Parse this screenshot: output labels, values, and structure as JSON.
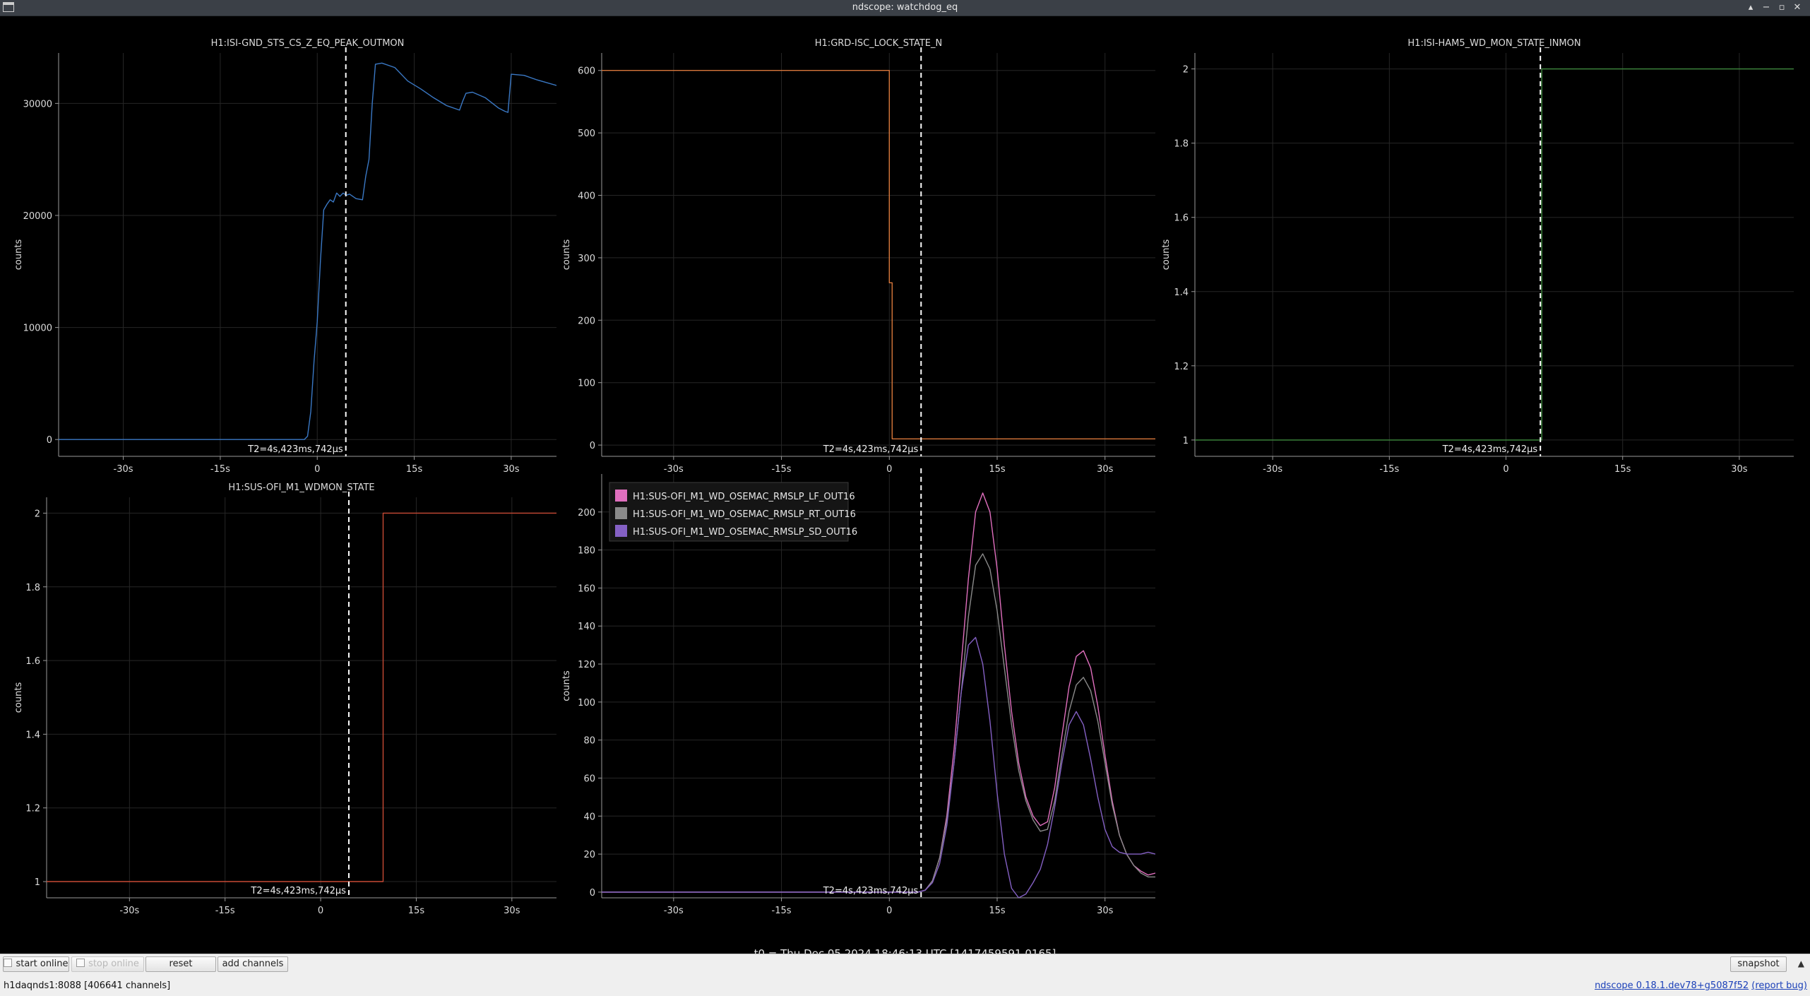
{
  "window": {
    "title": "ndscope: watchdog_eq",
    "controls": {
      "up": "▴",
      "minimize": "−",
      "maximize": "▫",
      "close": "✕"
    }
  },
  "cursor_label": "T2=4s,423ms,742µs",
  "cursor_t": 4.42,
  "t0_label": "t0 = Thu Dec 05 2024 18:46:13 UTC [1417459591.0165]",
  "toolbar": {
    "start_online": "start online",
    "stop_online": "stop online",
    "reset": "reset",
    "add_channels": "add channels",
    "snapshot": "snapshot"
  },
  "status": {
    "server": "h1daqnds1:8088  [406641 channels]",
    "version": "ndscope 0.18.1.dev78+g5087f52",
    "report_bug": "(report bug)"
  },
  "colors": {
    "background": "#000000",
    "grid": "#262626",
    "cursor": "#ffffff",
    "blue": "#3a78c4",
    "orange": "#d8773a",
    "green": "#3e8a3e",
    "red": "#c84a35",
    "pink": "#e06fbe",
    "gray": "#8a8a8a",
    "purple": "#8460c4"
  },
  "chart_data": [
    {
      "type": "line",
      "title": "H1:ISI-GND_STS_CS_Z_EQ_PEAK_OUTMON",
      "ylabel": "counts",
      "xlim": [
        -40,
        37
      ],
      "ylim": [
        -1500,
        34500
      ],
      "xticks": [
        -30,
        -15,
        0,
        15,
        30
      ],
      "xtick_labels": [
        "-30s",
        "-15s",
        "0",
        "15s",
        "30s"
      ],
      "yticks": [
        0,
        10000,
        20000,
        30000
      ],
      "ytick_labels": [
        "0",
        "10000",
        "20000",
        "30000"
      ],
      "grid": true,
      "series": [
        {
          "color": "#3a78c4",
          "x": [
            -40,
            -2,
            -1.5,
            -1,
            -0.5,
            0,
            0.5,
            1,
            1.5,
            2,
            2.5,
            3,
            3.5,
            4,
            4.5,
            5,
            6,
            7,
            7.5,
            8,
            8.5,
            9,
            10,
            12,
            14,
            16,
            18,
            20,
            22,
            22.5,
            23,
            24,
            26,
            28,
            29,
            29.5,
            30,
            32,
            34,
            37
          ],
          "y": [
            0,
            0,
            300,
            2500,
            7000,
            10500,
            16000,
            20500,
            21000,
            21400,
            21200,
            22000,
            21700,
            22000,
            21800,
            21900,
            21500,
            21400,
            23500,
            25000,
            30000,
            33500,
            33600,
            33200,
            32000,
            31300,
            30500,
            29800,
            29400,
            30200,
            30900,
            31000,
            30500,
            29600,
            29300,
            29200,
            32600,
            32500,
            32100,
            31600
          ]
        }
      ]
    },
    {
      "type": "line",
      "title": "H1:GRD-ISC_LOCK_STATE_N",
      "ylabel": "counts",
      "xlim": [
        -40,
        37
      ],
      "ylim": [
        -18,
        628
      ],
      "xticks": [
        -30,
        -15,
        0,
        15,
        30
      ],
      "xtick_labels": [
        "-30s",
        "-15s",
        "0",
        "15s",
        "30s"
      ],
      "yticks": [
        0,
        100,
        200,
        300,
        400,
        500,
        600
      ],
      "ytick_labels": [
        "0",
        "100",
        "200",
        "300",
        "400",
        "500",
        "600"
      ],
      "grid": true,
      "series": [
        {
          "color": "#d8773a",
          "x": [
            -40,
            0,
            0,
            0.4,
            0.4,
            37
          ],
          "y": [
            600,
            600,
            260,
            260,
            10,
            10
          ]
        }
      ]
    },
    {
      "type": "line",
      "title": "H1:ISI-HAM5_WD_MON_STATE_INMON",
      "ylabel": "counts",
      "xlim": [
        -40,
        37
      ],
      "ylim": [
        0.956,
        2.043
      ],
      "xticks": [
        -30,
        -15,
        0,
        15,
        30
      ],
      "xtick_labels": [
        "-30s",
        "-15s",
        "0",
        "15s",
        "30s"
      ],
      "yticks": [
        1,
        1.2,
        1.4,
        1.6,
        1.8,
        2
      ],
      "ytick_labels": [
        "1",
        "1.2",
        "1.4",
        "1.6",
        "1.8",
        "2"
      ],
      "grid": true,
      "series": [
        {
          "color": "#3e8a3e",
          "x": [
            -40,
            4.6,
            4.6,
            37
          ],
          "y": [
            1,
            1,
            2,
            2
          ]
        }
      ]
    },
    {
      "type": "line",
      "title": "H1:SUS-OFI_M1_WDMON_STATE",
      "ylabel": "counts",
      "xlim": [
        -43,
        37
      ],
      "ylim": [
        0.956,
        2.043
      ],
      "xticks": [
        -30,
        -15,
        0,
        15,
        30
      ],
      "xtick_labels": [
        "-30s",
        "-15s",
        "0",
        "15s",
        "30s"
      ],
      "yticks": [
        1,
        1.2,
        1.4,
        1.6,
        1.8,
        2
      ],
      "ytick_labels": [
        "1",
        "1.2",
        "1.4",
        "1.6",
        "1.8",
        "2"
      ],
      "grid": true,
      "series": [
        {
          "color": "#c84a35",
          "x": [
            -43,
            9.8,
            9.8,
            37
          ],
          "y": [
            1,
            1,
            2,
            2
          ]
        }
      ]
    },
    {
      "type": "line",
      "title": "",
      "ylabel": "counts",
      "xlim": [
        -40,
        37
      ],
      "ylim": [
        -3,
        220
      ],
      "xticks": [
        -30,
        -15,
        0,
        15,
        30
      ],
      "xtick_labels": [
        "-30s",
        "-15s",
        "0",
        "15s",
        "30s"
      ],
      "yticks": [
        0,
        20,
        40,
        60,
        80,
        100,
        120,
        140,
        160,
        180,
        200
      ],
      "ytick_labels": [
        "0",
        "20",
        "40",
        "60",
        "80",
        "100",
        "120",
        "140",
        "160",
        "180",
        "200"
      ],
      "grid": true,
      "legend": "top-left",
      "series": [
        {
          "name": "H1:SUS-OFI_M1_WD_OSEMAC_RMSLP_LF_OUT16",
          "color": "#e06fbe",
          "x": [
            -40,
            4,
            5,
            6,
            7,
            8,
            9,
            10,
            11,
            12,
            13,
            14,
            15,
            16,
            17,
            18,
            19,
            20,
            21,
            22,
            23,
            24,
            25,
            26,
            27,
            28,
            29,
            30,
            31,
            32,
            33,
            34,
            35,
            36,
            37
          ],
          "y": [
            0,
            0,
            1,
            6,
            18,
            40,
            75,
            120,
            165,
            200,
            210,
            200,
            170,
            130,
            95,
            68,
            50,
            40,
            35,
            37,
            55,
            82,
            108,
            124,
            127,
            118,
            98,
            72,
            48,
            30,
            20,
            14,
            11,
            9,
            10
          ]
        },
        {
          "name": "H1:SUS-OFI_M1_WD_OSEMAC_RMSLP_RT_OUT16",
          "color": "#8a8a8a",
          "x": [
            -40,
            4,
            5,
            6,
            7,
            8,
            9,
            10,
            11,
            12,
            13,
            14,
            15,
            16,
            17,
            18,
            19,
            20,
            21,
            22,
            23,
            24,
            25,
            26,
            27,
            28,
            29,
            30,
            31,
            32,
            33,
            34,
            35,
            36,
            37
          ],
          "y": [
            0,
            0,
            1,
            6,
            18,
            38,
            68,
            105,
            145,
            172,
            178,
            170,
            148,
            118,
            88,
            64,
            48,
            38,
            32,
            33,
            48,
            72,
            95,
            109,
            113,
            106,
            90,
            68,
            46,
            30,
            20,
            14,
            10,
            8,
            8
          ]
        },
        {
          "name": "H1:SUS-OFI_M1_WD_OSEMAC_RMSLP_SD_OUT16",
          "color": "#8460c4",
          "x": [
            -40,
            4,
            5,
            6,
            7,
            8,
            9,
            10,
            11,
            12,
            13,
            14,
            15,
            16,
            17,
            18,
            19,
            20,
            21,
            22,
            23,
            24,
            25,
            26,
            27,
            28,
            29,
            30,
            31,
            32,
            33,
            34,
            35,
            36,
            37
          ],
          "y": [
            0,
            0,
            1,
            5,
            15,
            35,
            68,
            105,
            130,
            134,
            120,
            90,
            52,
            20,
            2,
            -3,
            -1,
            5,
            12,
            25,
            45,
            68,
            88,
            95,
            88,
            70,
            50,
            33,
            24,
            21,
            20,
            20,
            20,
            21,
            20
          ]
        }
      ]
    }
  ]
}
